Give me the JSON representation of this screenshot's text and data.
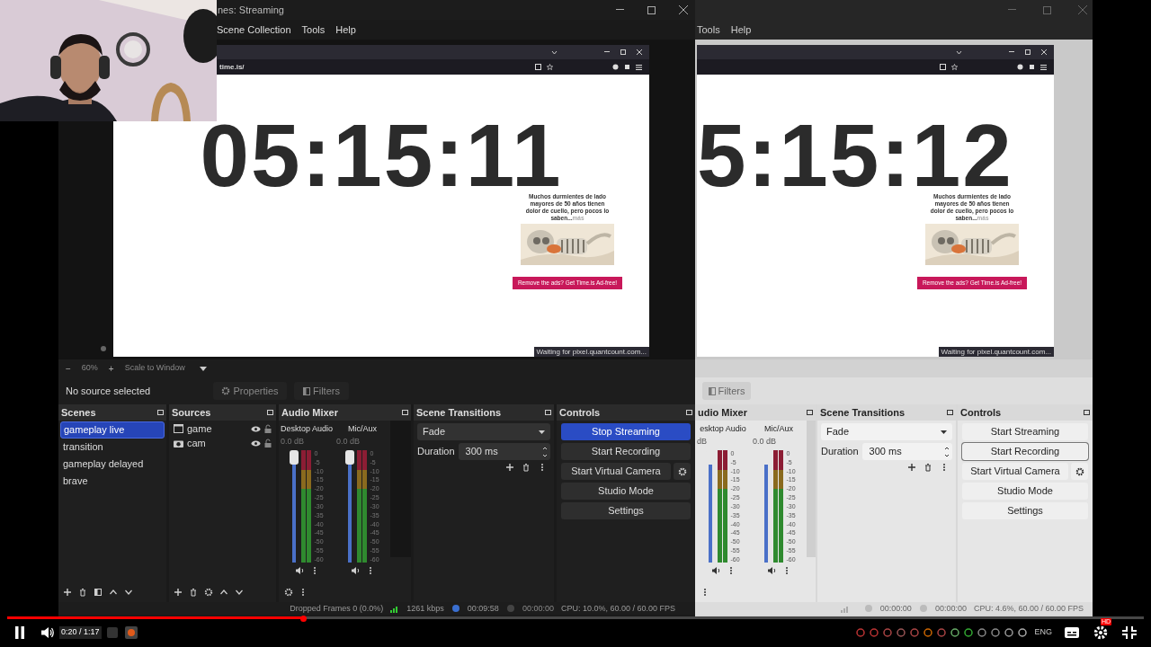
{
  "left": {
    "title": "nes: Streaming",
    "menu": [
      "Scene Collection",
      "Tools",
      "Help"
    ],
    "browser": {
      "url": "time.is/",
      "clock": "05:15:11",
      "ad_text": "Muchos durmientes de lado mayores de 50 años tienen dolor de cuello, pero pocos lo saben...",
      "ad_more": "más",
      "ad_button": "Remove the ads? Get Time.is Ad-free!",
      "status": "Waiting for pixel.quantcount.com..."
    },
    "zoom": {
      "minus": "−",
      "percent": "60%",
      "plus": "+",
      "scale": "Scale to Window"
    },
    "source_bar": {
      "label": "No source selected",
      "properties": "Properties",
      "filters": "Filters"
    },
    "scenes": {
      "title": "Scenes",
      "items": [
        {
          "label": "gameplay live",
          "selected": true
        },
        {
          "label": "transition",
          "selected": false
        },
        {
          "label": "gameplay delayed",
          "selected": false
        },
        {
          "label": "brave",
          "selected": false
        }
      ]
    },
    "sources": {
      "title": "Sources",
      "items": [
        {
          "label": "game",
          "kind": "window"
        },
        {
          "label": "cam",
          "kind": "camera"
        }
      ]
    },
    "mixer": {
      "title": "Audio Mixer",
      "channels": [
        {
          "name": "Desktop Audio",
          "reading": "0.0 dB",
          "level": 1,
          "scale": [
            "0",
            "-5",
            "-10",
            "-15",
            "-20",
            "-25",
            "-30",
            "-35",
            "-40",
            "-45",
            "-50",
            "-55",
            "-60"
          ]
        },
        {
          "name": "Mic/Aux",
          "reading": "0.0 dB",
          "level": 1,
          "scale": [
            "0",
            "-5",
            "-10",
            "-15",
            "-20",
            "-25",
            "-30",
            "-35",
            "-40",
            "-45",
            "-50",
            "-55",
            "-60"
          ]
        }
      ]
    },
    "transitions": {
      "title": "Scene Transitions",
      "transition": "Fade",
      "duration_label": "Duration",
      "duration": "300 ms"
    },
    "controls": {
      "title": "Controls",
      "buttons": [
        {
          "label": "Stop Streaming",
          "kind": "button",
          "active": true,
          "focused": false
        },
        {
          "label": "Start Recording",
          "kind": "button",
          "active": false,
          "focused": false
        },
        {
          "label": "Start Virtual Camera",
          "kind": "with_settings",
          "active": false,
          "focused": false
        },
        {
          "label": "Studio Mode",
          "kind": "button",
          "active": false,
          "focused": false
        },
        {
          "label": "Settings",
          "kind": "button",
          "active": false,
          "focused": false
        }
      ]
    },
    "status_bar": {
      "dropped": "Dropped Frames 0 (0.0%)",
      "bitrate": "1261 kbps",
      "stream_time": "00:09:58",
      "record_time": "00:00:00",
      "cpu": "CPU: 10.0%, 60.00 / 60.00 FPS"
    }
  },
  "right": {
    "menu": [
      "Tools",
      "Help"
    ],
    "browser": {
      "clock": "5:15:12",
      "ad_text": "Muchos durmientes de lado mayores de 50 años tienen dolor de cuello, pero pocos lo saben...",
      "ad_more": "más",
      "ad_button": "Remove the ads? Get Time.is Ad-free!",
      "status": "Waiting for pixel.quantcount.com..."
    },
    "source_bar": {
      "filters": "Filters"
    },
    "mixer": {
      "title": "udio Mixer",
      "channels": [
        {
          "name": "esktop Audio",
          "reading": "dB",
          "level": 1,
          "scale": [
            "0",
            "-5",
            "-10",
            "-15",
            "-20",
            "-25",
            "-30",
            "-35",
            "-40",
            "-45",
            "-50",
            "-55",
            "-60"
          ]
        },
        {
          "name": "Mic/Aux",
          "reading": "0.0 dB",
          "level": 1,
          "scale": [
            "0",
            "-5",
            "-10",
            "-15",
            "-20",
            "-25",
            "-30",
            "-35",
            "-40",
            "-45",
            "-50",
            "-55",
            "-60"
          ]
        }
      ]
    },
    "transitions": {
      "title": "Scene Transitions",
      "transition": "Fade",
      "duration_label": "Duration",
      "duration": "300 ms"
    },
    "controls": {
      "title": "Controls",
      "buttons": [
        {
          "label": "Start Streaming",
          "kind": "button",
          "active": false,
          "focused": false
        },
        {
          "label": "Start Recording",
          "kind": "button",
          "active": false,
          "focused": true
        },
        {
          "label": "Start Virtual Camera",
          "kind": "with_settings",
          "active": false,
          "focused": false
        },
        {
          "label": "Studio Mode",
          "kind": "button",
          "active": false,
          "focused": false
        },
        {
          "label": "Settings",
          "kind": "button",
          "active": false,
          "focused": false
        }
      ]
    },
    "status_bar": {
      "stream_time": "00:00:00",
      "record_time": "00:00:00",
      "cpu": "CPU: 4.6%, 60.00 / 60.00 FPS"
    }
  },
  "player": {
    "playing": true,
    "progress": {
      "level": 0.26
    },
    "time": "0:20 / 1:17",
    "language": "ENG",
    "settings_badge": "HD"
  }
}
